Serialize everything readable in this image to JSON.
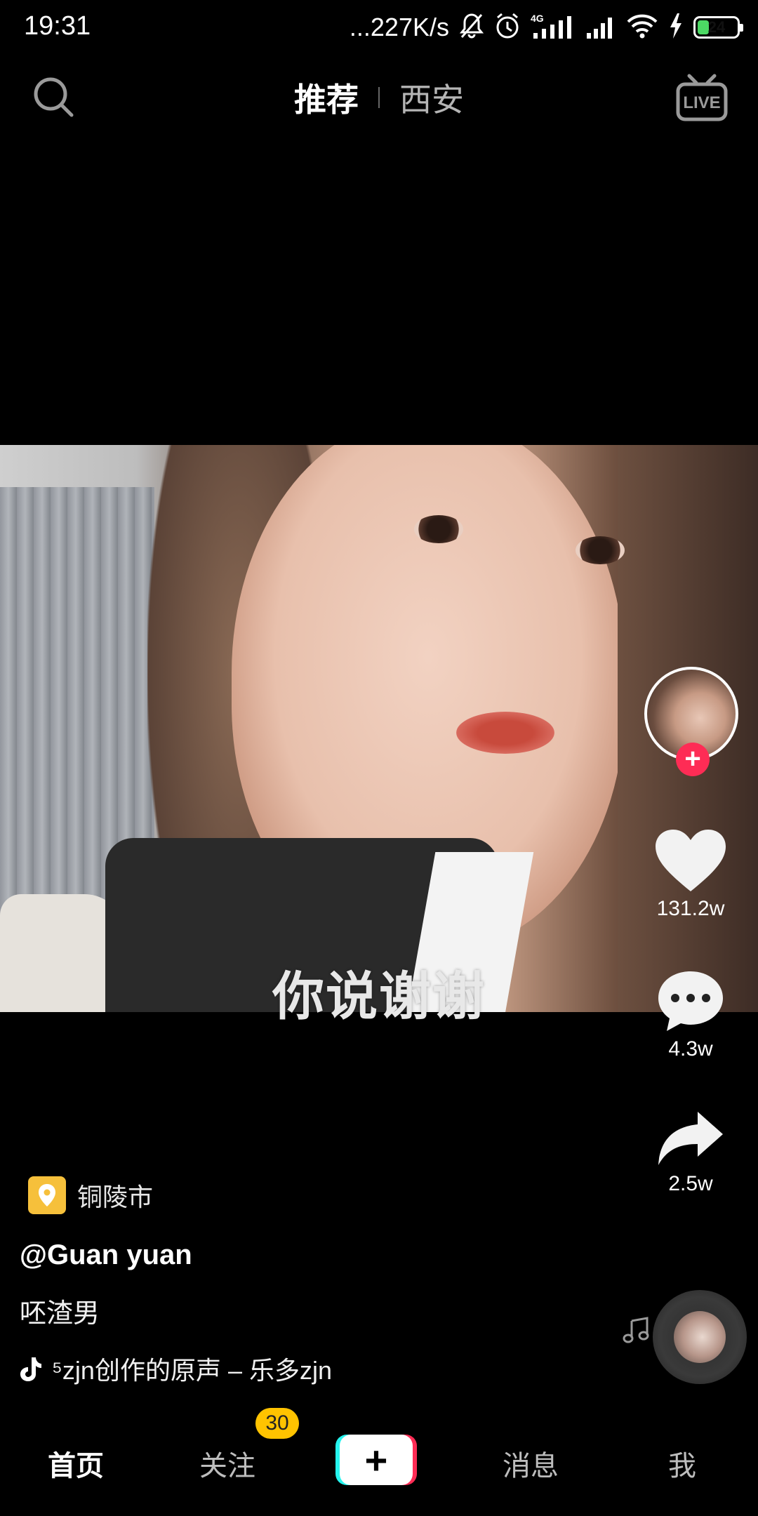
{
  "status_bar": {
    "time": "19:31",
    "net_speed": "...227K/s",
    "battery": "24"
  },
  "top_nav": {
    "tabs": [
      {
        "label": "推荐",
        "active": true
      },
      {
        "label": "西安",
        "active": false
      }
    ],
    "live_icon": "live-icon",
    "search_icon": "search-icon"
  },
  "video": {
    "subtitle": "你说谢谢"
  },
  "actions": {
    "likes": "131.2w",
    "comments": "4.3w",
    "shares": "2.5w"
  },
  "post": {
    "location": "铜陵市",
    "author": "@Guan yuan",
    "caption": "呸渣男",
    "music": "⁵zjn创作的原声 – 乐多zjn"
  },
  "bottom_nav": {
    "items": [
      "首页",
      "关注",
      "消息",
      "我"
    ],
    "follow_badge": "30"
  },
  "colors": {
    "accent_red": "#fe2c55",
    "accent_cyan": "#25f4ee",
    "badge_yellow": "#ffc300",
    "location_yellow": "#f6c03b"
  }
}
